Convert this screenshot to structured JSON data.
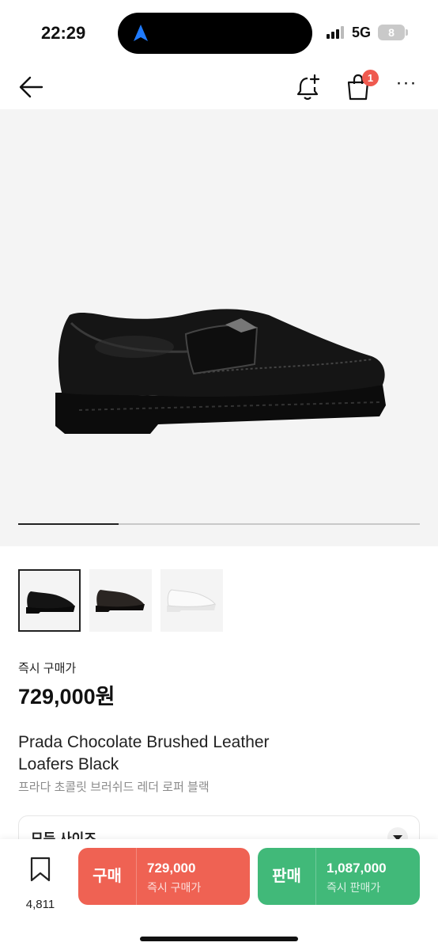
{
  "status_bar": {
    "time": "22:29",
    "network": "5G",
    "battery": "8",
    "icons": [
      "location-arrow-icon",
      "signal-icon",
      "battery-icon"
    ]
  },
  "header": {
    "icons": [
      "back-arrow-icon",
      "bell-plus-icon",
      "shopping-bag-icon",
      "more-icon"
    ],
    "bag_badge": "1"
  },
  "gallery": {
    "progress_fraction": 0.25,
    "thumbnails": [
      {
        "color": "#141414",
        "selected": true
      },
      {
        "color": "#2a2522",
        "selected": false
      },
      {
        "color": "#f2f2f2",
        "selected": false
      }
    ]
  },
  "product": {
    "price_label": "즉시 구매가",
    "price": "729,000원",
    "name_en_line1": "Prada Chocolate Brushed Leather",
    "name_en_line2": "Loafers Black",
    "name_ko": "프라다 초콜릿 브러쉬드 레더 로퍼 블랙"
  },
  "size_selector": {
    "label": "모든 사이즈"
  },
  "bottom_bar": {
    "bookmark_count": "4,811",
    "buy": {
      "label": "구매",
      "price": "729,000",
      "sub": "즉시 구매가",
      "color": "#ef6253"
    },
    "sell": {
      "label": "판매",
      "price": "1,087,000",
      "sub": "즉시 판매가",
      "color": "#41b979"
    }
  }
}
